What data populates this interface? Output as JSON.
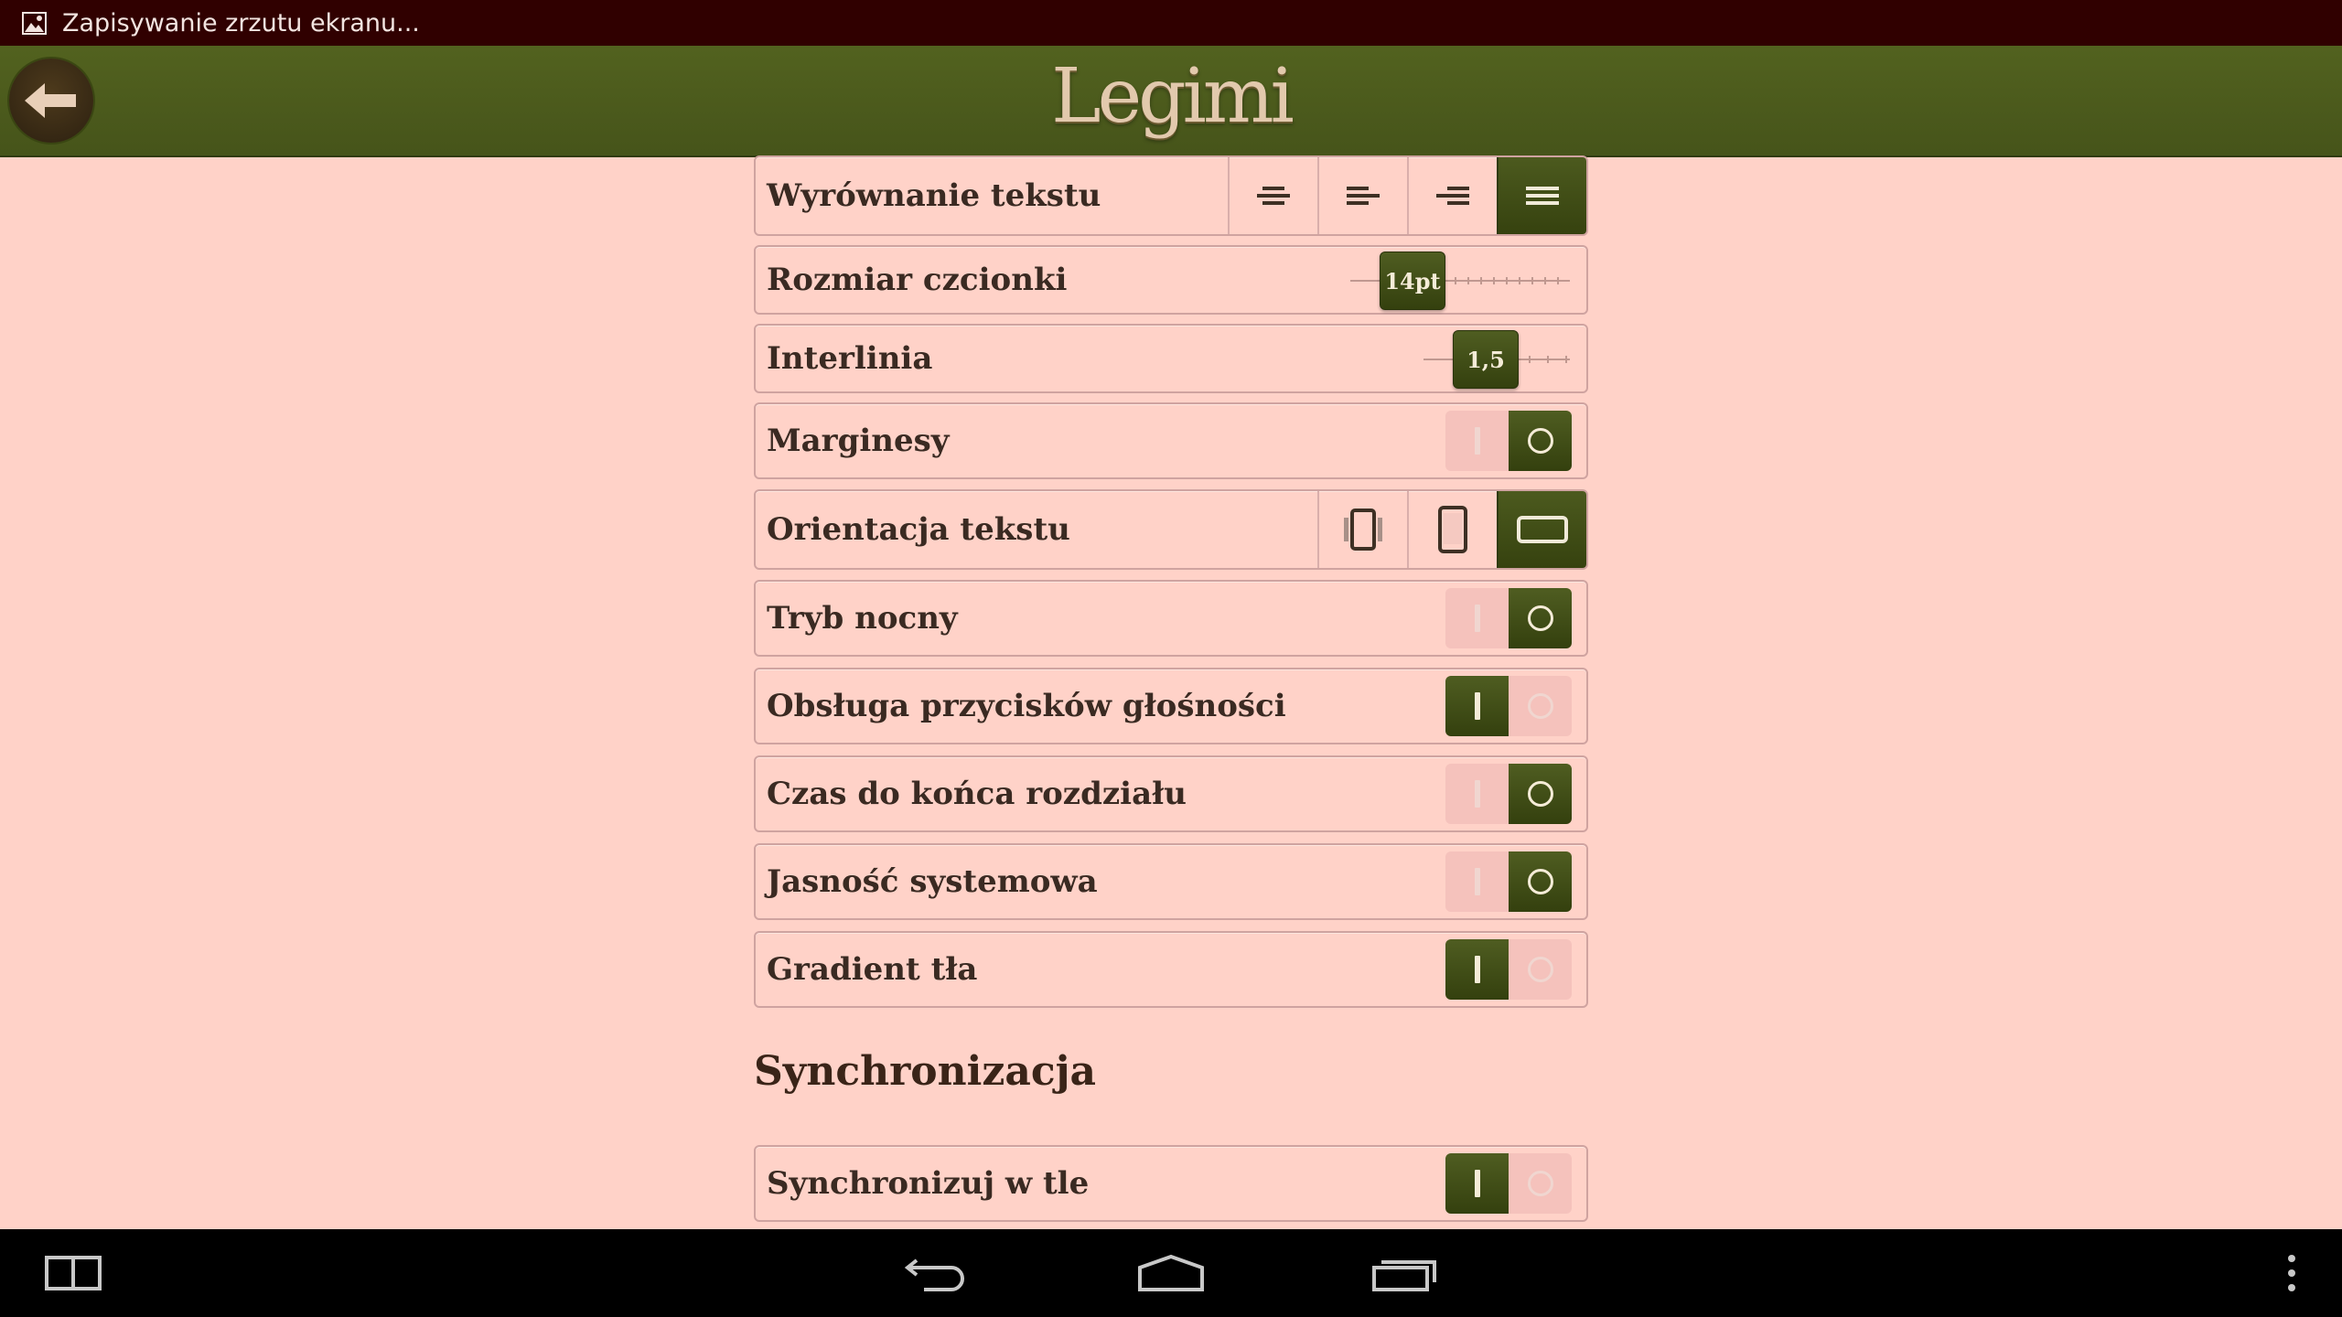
{
  "status_bar": {
    "notification_text": "Zapisywanie zrzutu ekranu...",
    "notification_icon": "image-icon"
  },
  "header": {
    "logo_text": "Legimi",
    "back_icon": "back-arrow-icon"
  },
  "settings": {
    "text_alignment": {
      "label": "Wyrównanie tekstu",
      "options": [
        "align-center-icon",
        "align-left-icon",
        "align-right-icon",
        "align-justify-icon"
      ],
      "selected": "align-justify-icon"
    },
    "font_size": {
      "label": "Rozmiar czcionki",
      "value": "14pt"
    },
    "line_spacing": {
      "label": "Interlinia",
      "value": "1,5"
    },
    "margins": {
      "label": "Marginesy",
      "on": false
    },
    "text_orientation": {
      "label": "Orientacja tekstu",
      "options": [
        "auto-rotate-icon",
        "portrait-icon",
        "landscape-icon"
      ],
      "selected": "landscape-icon"
    },
    "night_mode": {
      "label": "Tryb nocny",
      "on": false
    },
    "volume_buttons": {
      "label": "Obsługa przycisków głośności",
      "on": true
    },
    "chapter_time": {
      "label": "Czas do końca rozdziału",
      "on": false
    },
    "system_brightness": {
      "label": "Jasność systemowa",
      "on": false
    },
    "background_gradient": {
      "label": "Gradient tła",
      "on": true
    }
  },
  "sync": {
    "title": "Synchronizacja",
    "background_sync": {
      "label": "Synchronizuj w tle",
      "on": true
    }
  },
  "nav_bar": {
    "buttons": [
      "split-screen-icon",
      "back-icon",
      "home-icon",
      "recent-apps-icon",
      "overflow-menu-icon"
    ]
  },
  "colors": {
    "accent": "#46541a",
    "background": "#ffd2c8",
    "status_bar": "#300000"
  }
}
